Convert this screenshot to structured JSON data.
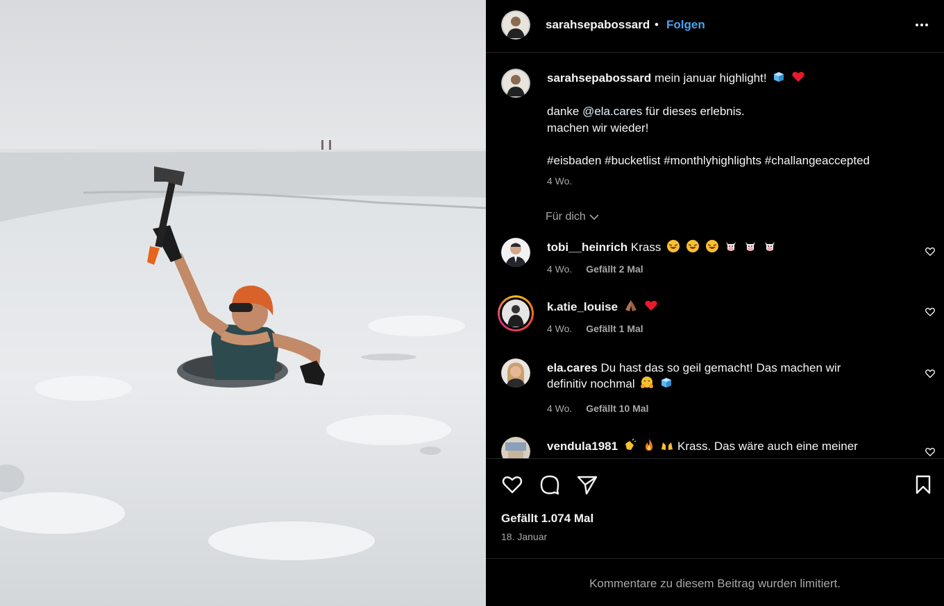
{
  "post": {
    "username": "sarahsepabossard",
    "separator": "•",
    "follow_label": "Folgen"
  },
  "caption": {
    "username": "sarahsepabossard",
    "line1": "mein januar highlight!",
    "line2_prefix": "danke",
    "line2_mention": "@ela.cares",
    "line2_suffix": "für dieses erlebnis.",
    "line3": "machen wir wieder!",
    "hashtags": "#eisbaden #bucketlist #monthlyhighlights #challangeaccepted",
    "time": "4 Wo."
  },
  "for_you_label": "Für dich",
  "comments": [
    {
      "username": "tobi__heinrich",
      "text": "Krass",
      "time": "4 Wo.",
      "likes": "Gefällt 2 Mal"
    },
    {
      "username": "k.atie_louise",
      "text": "",
      "time": "4 Wo.",
      "likes": "Gefällt 1 Mal"
    },
    {
      "username": "ela.cares",
      "text": "Du hast das so geil gemacht! Das machen wir",
      "text2": "definitiv nochmal",
      "time": "4 Wo.",
      "likes": "Gefällt 10 Mal"
    },
    {
      "username": "vendula1981",
      "text": "Krass. Das wäre auch eine meiner"
    }
  ],
  "likes_total": "Gefällt 1.074 Mal",
  "date": "18. Januar",
  "comments_limited": "Kommentare zu diesem Beitrag wurden limitiert.",
  "icons": {
    "more": "more-horizontal-icon",
    "like": "heart-icon",
    "comment": "comment-bubble-icon",
    "share": "paper-plane-icon",
    "save": "bookmark-icon"
  },
  "colors": {
    "background": "#000000",
    "follow_link": "#4aa3f0",
    "secondary_text": "#a8a8a8",
    "divider": "#262626",
    "heart_red": "#ff3040"
  }
}
